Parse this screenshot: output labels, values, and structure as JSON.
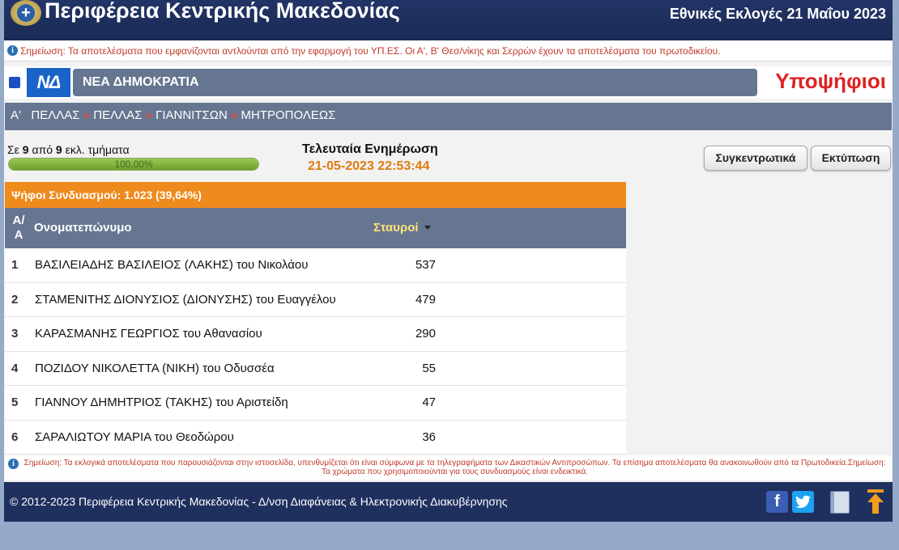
{
  "header": {
    "title": "Περιφέρεια Κεντρικής Μακεδονίας",
    "election": "Εθνικές Εκλογές 21 Μαΐου 2023"
  },
  "notice": {
    "text": "Σημείωση: Τα αποτελέσματα που εμφανίζονται αντλούνται από την εφαρμογή του ΥΠ.ΕΣ. Οι Α', Β' Θεσ/νίκης και Σερρών έχουν τα αποτελέσματα του πρωτοδικείου."
  },
  "party": {
    "logo_text": "ΝΔ",
    "name": "ΝΕΑ ΔΗΜΟΚΡΑΤΙΑ",
    "color": "#1f4fbf"
  },
  "candidates_title": "Υποψήφιοι",
  "breadcrumb": {
    "root": "Α'",
    "items": [
      "ΠΕΛΛΑΣ",
      "ΠΕΛΛΑΣ",
      "ΓΙΑΝΝΙΤΣΩΝ",
      "ΜΗΤΡΟΠΟΛΕΩΣ"
    ],
    "separator": "»"
  },
  "progress": {
    "prefix": "Σε",
    "counted": "9",
    "middle": "από",
    "total": "9",
    "suffix": "εκλ. τμήματα",
    "percent_text": "100,00%",
    "fraction": 1.0
  },
  "update": {
    "label": "Τελευταία Ενημέρωση",
    "time": "21-05-2023 22:53:44"
  },
  "buttons": {
    "summary": "Συγκεντρωτικά",
    "print": "Εκτύπωση"
  },
  "votes_summary": "Ψήφοι Συνδυασμού: 1.023 (39,64%)",
  "table": {
    "col_aa_1": "Α/",
    "col_aa_2": "Α",
    "col_name": "Ονοματεπώνυμο",
    "col_votes": "Σταυροί",
    "rows": [
      {
        "num": "1",
        "name": "ΒΑΣΙΛΕΙΑΔΗΣ ΒΑΣΙΛΕΙΟΣ (ΛΑΚΗΣ) του Νικολάου",
        "votes": "537"
      },
      {
        "num": "2",
        "name": "ΣΤΑΜΕΝΙΤΗΣ ΔΙΟΝΥΣΙΟΣ (ΔΙΟΝΥΣΗΣ) του Ευαγγέλου",
        "votes": "479"
      },
      {
        "num": "3",
        "name": "ΚΑΡΑΣΜΑΝΗΣ ΓΕΩΡΓΙΟΣ του Αθανασίου",
        "votes": "290"
      },
      {
        "num": "4",
        "name": "ΠΟΖΙΔΟΥ ΝΙΚΟΛΕΤΤΑ (ΝΙΚΗ) του Οδυσσέα",
        "votes": "55"
      },
      {
        "num": "5",
        "name": "ΓΙΑΝΝΟΥ ΔΗΜΗΤΡΙΟΣ (ΤΑΚΗΣ) του Αριστείδη",
        "votes": "47"
      },
      {
        "num": "6",
        "name": "ΣΑΡΑΛΙΩΤΟΥ ΜΑΡΙΑ του Θεοδώρου",
        "votes": "36"
      }
    ]
  },
  "footnote": "Σημείωση: Τα εκλογικά αποτελέσματα που παρουσιάζονται στην ιστοσελίδα, υπενθυμίζεται ότι είναι σύμφωνα με τα τηλεγραφήματα των Δικαστικών Αντιπροσώπων. Τα επίσημα αποτελέσματα θα ανακοινωθούν από τα Πρωτοδικεία.Σημείωση: Τα χρώματα που χρησιμοποιούνται για τους συνδυασμούς είναι ενδεικτικά.",
  "footer": {
    "copyright": "© 2012-2023 Περιφέρεια Κεντρικής Μακεδονίας - Δ/νση Διαφάνειας & Ηλεκτρονικής Διακυβέρνησης",
    "facebook_letter": "f"
  },
  "colors": {
    "header": "#1f2f5e",
    "accent_orange": "#ef8a1c",
    "slate": "#667690",
    "red": "#dd2222"
  }
}
